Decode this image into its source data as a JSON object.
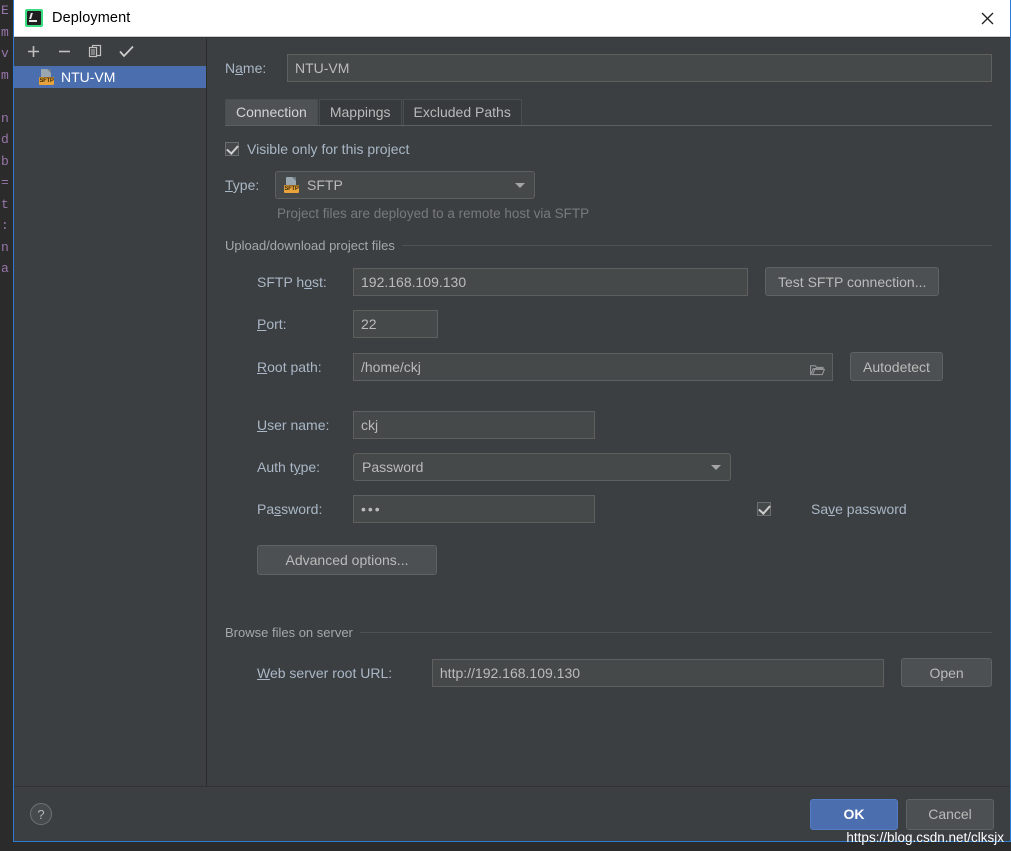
{
  "window": {
    "title": "Deployment",
    "app_icon": "pycharm-icon",
    "close_label": "✕"
  },
  "background_editor": {
    "gutter_chars": "E\nm\nv\nm\n\nn\nd\nb\n=\nt\n:\nn\na"
  },
  "left_panel": {
    "toolbar": [
      {
        "name": "add-button",
        "glyph": "＋"
      },
      {
        "name": "remove-button",
        "glyph": "−"
      },
      {
        "name": "copy-button",
        "glyph": "⧉"
      },
      {
        "name": "use-as-default-button",
        "glyph": "✓"
      }
    ],
    "servers": [
      {
        "name": "NTU-VM",
        "icon": "sftp-server-icon",
        "badge": "SFTP",
        "selected": true
      }
    ]
  },
  "form": {
    "name_label": "Name:",
    "name_value": "NTU-VM",
    "name_placeholder": "",
    "tabs": [
      {
        "label": "Connection",
        "active": true
      },
      {
        "label": "Mappings",
        "active": false
      },
      {
        "label": "Excluded Paths",
        "active": false
      }
    ],
    "visible_only_label": "Visible only for this project",
    "visible_only_checked": true,
    "type_label": "Type:",
    "type_value": "SFTP",
    "type_badge": "SFTP",
    "type_hint": "Project files are deployed to a remote host via SFTP",
    "upload_group_title": "Upload/download project files",
    "sftp_host_label": "SFTP host:",
    "sftp_host_value": "192.168.109.130",
    "test_connection_label": "Test SFTP connection...",
    "port_label": "Port:",
    "port_value": "22",
    "root_path_label": "Root path:",
    "root_path_value": "/home/ckj",
    "autodetect_label": "Autodetect",
    "user_name_label": "User name:",
    "user_name_value": "ckj",
    "auth_type_label": "Auth type:",
    "auth_type_value": "Password",
    "password_label": "Password:",
    "password_value": "•••",
    "save_password_label": "Save password",
    "save_password_checked": true,
    "advanced_options_label": "Advanced options...",
    "browse_group_title": "Browse files on server",
    "web_url_label": "Web server root URL:",
    "web_url_value": "http://192.168.109.130",
    "open_label": "Open"
  },
  "footer": {
    "help_label": "?",
    "ok_label": "OK",
    "cancel_label": "Cancel",
    "watermark": "https://blog.csdn.net/clksjx"
  },
  "colors": {
    "dialog_bg": "#3c3f41",
    "field_bg": "#45494a",
    "text": "#a9b7c6",
    "accent_blue": "#4b6eaf",
    "selection_blue": "#4b6eaf",
    "border_blue": "#2d7bd4",
    "sftp_badge_orange": "#e8a33d"
  }
}
